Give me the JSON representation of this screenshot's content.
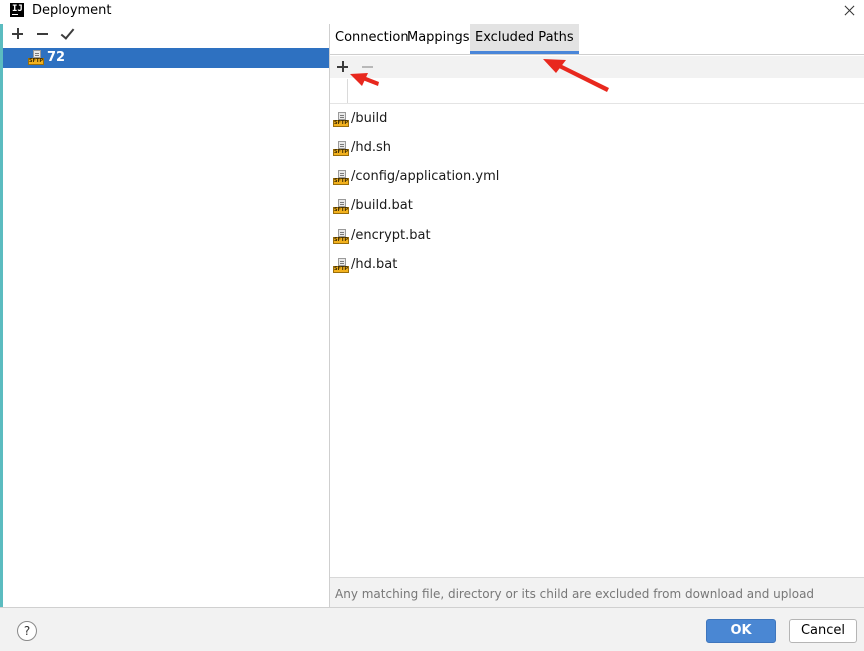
{
  "window": {
    "title": "Deployment",
    "logo_text": "IJ"
  },
  "left_panel": {
    "toolbar": {
      "add_icon": "plus-icon",
      "remove_icon": "minus-icon",
      "apply_icon": "check-icon"
    },
    "servers": [
      {
        "name": "72",
        "icon": "sftp-icon",
        "selected": true
      }
    ]
  },
  "tabs": [
    {
      "label": "Connection",
      "active": false
    },
    {
      "label": "Mappings",
      "active": false
    },
    {
      "label": "Excluded Paths",
      "active": true
    }
  ],
  "excluded": {
    "toolbar": {
      "add_icon": "plus-icon",
      "remove_icon": "minus-icon"
    },
    "input_value": "",
    "paths": [
      "/build",
      "/hd.sh",
      "/config/application.yml",
      "/build.bat",
      "/encrypt.bat",
      "/hd.bat"
    ],
    "note": "Any matching file, directory or its child are excluded from download and upload"
  },
  "buttons": {
    "help": "?",
    "ok": "OK",
    "cancel": "Cancel"
  },
  "sftp_badge": "SFTP",
  "colors": {
    "selection": "#2e71c1",
    "accent": "#4a87d3",
    "annotation_arrow": "#e8281e"
  }
}
